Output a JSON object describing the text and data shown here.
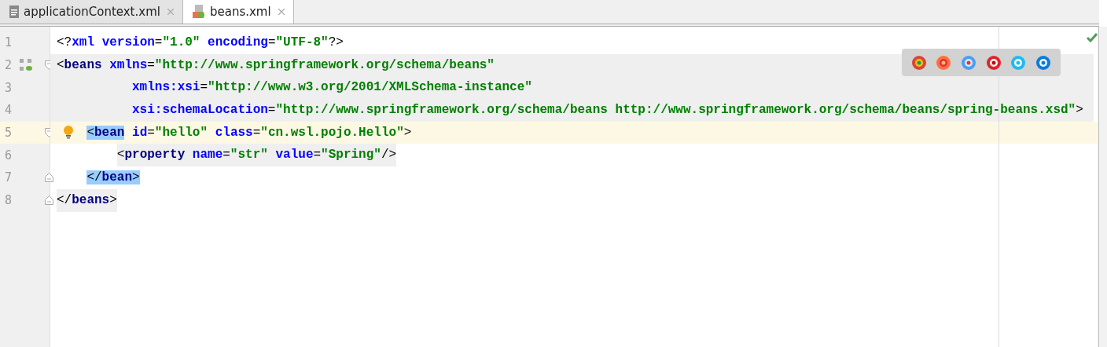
{
  "tabs": [
    {
      "label": "applicationContext.xml",
      "selected": false,
      "spring": false
    },
    {
      "label": "beans.xml",
      "selected": true,
      "spring": true
    }
  ],
  "editor": {
    "lines": [
      {
        "number": "1",
        "text": "<?xml version=\"1.0\" encoding=\"UTF-8\"?>",
        "current": false,
        "match": false,
        "block": false,
        "shaded": false,
        "bean_icon": false,
        "bulb": false,
        "fold_start": false,
        "fold_end": false
      },
      {
        "number": "2",
        "text": "<beans xmlns=\"http://www.springframework.org/schema/beans\"",
        "current": false,
        "match": false,
        "block": true,
        "shaded": false,
        "bean_icon": true,
        "bulb": false,
        "fold_start": true,
        "fold_end": false
      },
      {
        "number": "3",
        "text": "          xmlns:xsi=\"http://www.w3.org/2001/XMLSchema-instance\"",
        "current": false,
        "match": false,
        "block": true,
        "shaded": false,
        "bean_icon": false,
        "bulb": false,
        "fold_start": false,
        "fold_end": false
      },
      {
        "number": "4",
        "text": "          xsi:schemaLocation=\"http://www.springframework.org/schema/beans http://www.springframework.org/schema/beans/spring-beans.xsd\">",
        "current": false,
        "match": false,
        "block": true,
        "shaded": false,
        "bean_icon": false,
        "bulb": false,
        "fold_start": false,
        "fold_end": false
      },
      {
        "number": "5",
        "text": "    <bean id=\"hello\" class=\"cn.wsl.pojo.Hello\">",
        "current": true,
        "match": true,
        "block": false,
        "shaded": false,
        "bean_icon": false,
        "bulb": true,
        "fold_start": true,
        "fold_end": false
      },
      {
        "number": "6",
        "text": "        <property name=\"str\" value=\"Spring\"/>",
        "current": false,
        "match": false,
        "block": false,
        "shaded": true,
        "bean_icon": false,
        "bulb": false,
        "fold_start": false,
        "fold_end": false
      },
      {
        "number": "7",
        "text": "    </bean>",
        "current": false,
        "match": true,
        "block": false,
        "shaded": false,
        "bean_icon": false,
        "bulb": false,
        "fold_start": false,
        "fold_end": true
      },
      {
        "number": "8",
        "text": "</beans>",
        "current": false,
        "match": false,
        "block": false,
        "shaded": true,
        "bean_icon": false,
        "bulb": false,
        "fold_start": false,
        "fold_end": true
      }
    ]
  }
}
